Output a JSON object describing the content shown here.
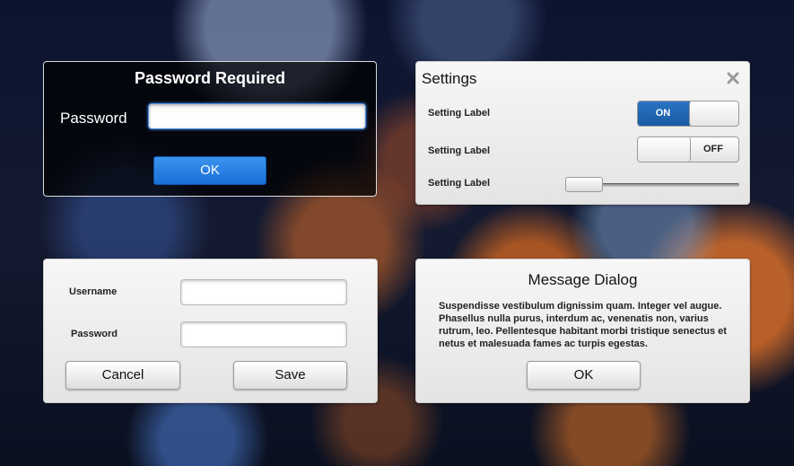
{
  "password_dialog": {
    "title": "Password Required",
    "password_label": "Password",
    "password_value": "",
    "ok_label": "OK",
    "accent": "#1f7be0"
  },
  "settings": {
    "title": "Settings",
    "close_icon": "close-icon",
    "items": [
      {
        "label": "Setting Label",
        "control": "toggle",
        "state": "ON"
      },
      {
        "label": "Setting Label",
        "control": "toggle",
        "state": "OFF"
      },
      {
        "label": "Setting Label",
        "control": "slider",
        "value_fraction": 0.0
      }
    ],
    "toggle_on_color": "#1f66b4"
  },
  "login": {
    "username_label": "Username",
    "password_label": "Password",
    "username_value": "",
    "password_value": "",
    "cancel_label": "Cancel",
    "save_label": "Save"
  },
  "message_dialog": {
    "title": "Message Dialog",
    "body": "Suspendisse vestibulum dignissim quam. Integer vel augue. Phasellus nulla purus, interdum ac, venenatis non, varius rutrum, leo. Pellentesque habitant morbi tristique senectus et netus et malesuada fames ac turpis egestas.",
    "ok_label": "OK"
  }
}
